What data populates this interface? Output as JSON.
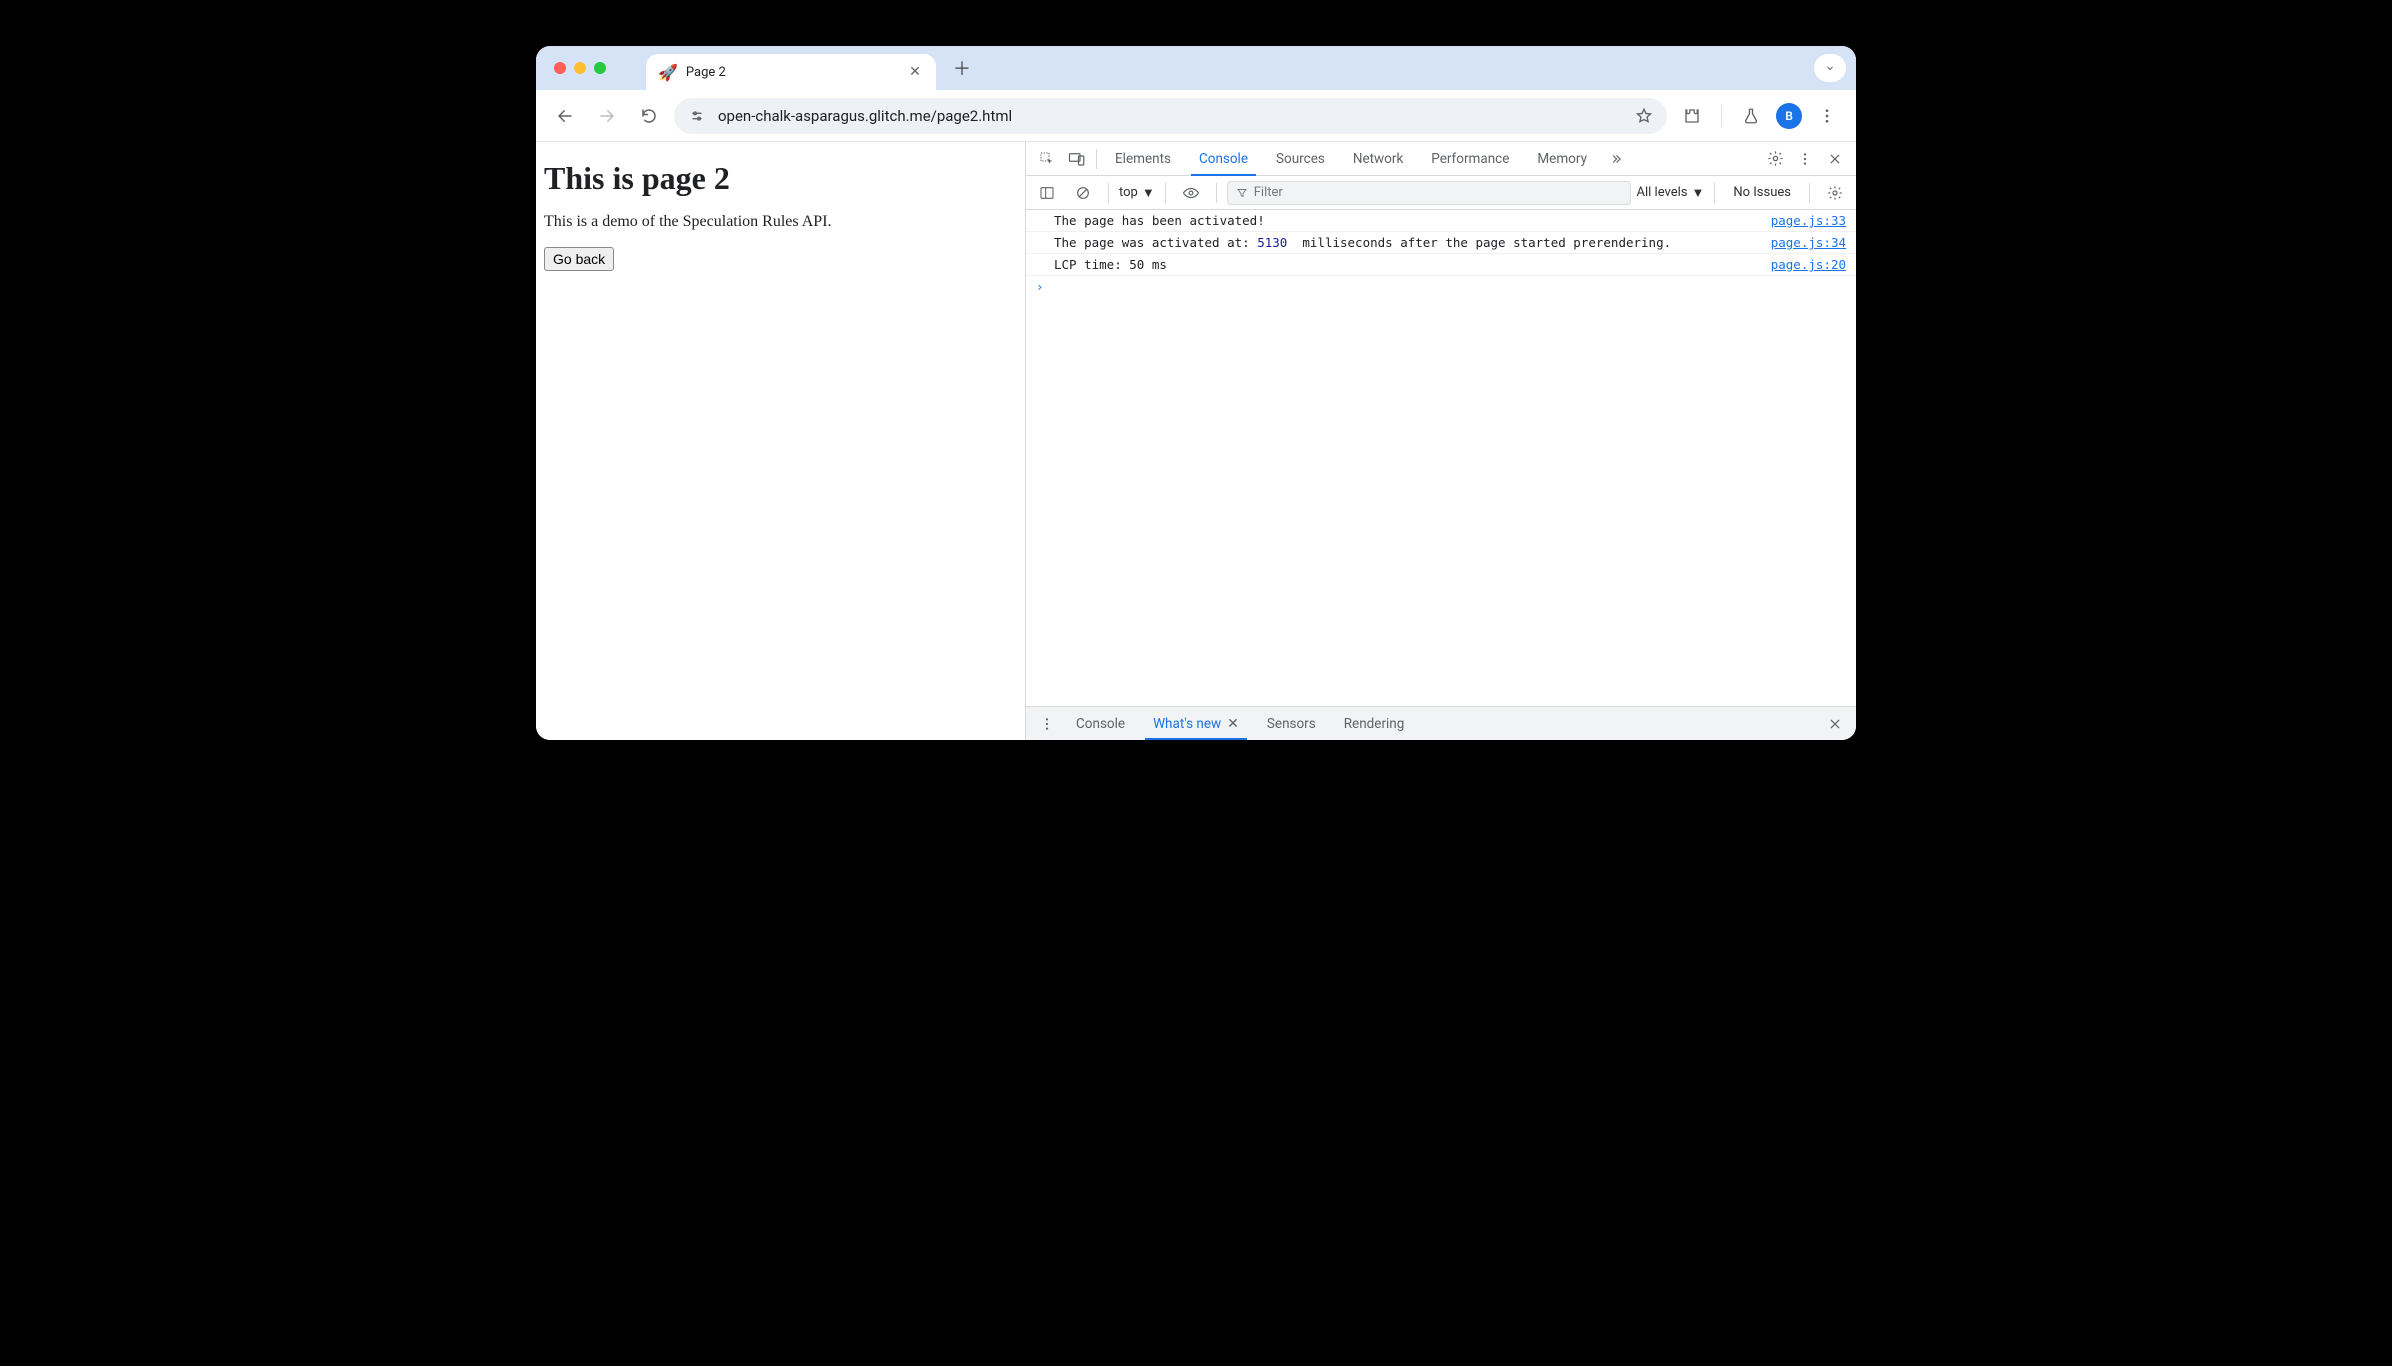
{
  "tab": {
    "favicon": "🚀",
    "title": "Page 2"
  },
  "toolbar": {
    "url": "open-chalk-asparagus.glitch.me/page2.html",
    "avatar_letter": "B"
  },
  "page": {
    "heading": "This is page 2",
    "body": "This is a demo of the Speculation Rules API.",
    "button": "Go back"
  },
  "devtools": {
    "tabs": [
      "Elements",
      "Console",
      "Sources",
      "Network",
      "Performance",
      "Memory"
    ],
    "active_tab": "Console",
    "context": "top",
    "filter_placeholder": "Filter",
    "levels_label": "All levels",
    "issues_label": "No Issues",
    "logs": [
      {
        "msg_pre": "The page has been activated!",
        "num": "",
        "msg_post": "",
        "src": "page.js:33"
      },
      {
        "msg_pre": "The page was activated at: ",
        "num": "5130",
        "msg_post": "  milliseconds after the page started prerendering.",
        "src": "page.js:34"
      },
      {
        "msg_pre": "LCP time: 50 ms",
        "num": "",
        "msg_post": "",
        "src": "page.js:20"
      }
    ],
    "drawer_tabs": [
      "Console",
      "What's new",
      "Sensors",
      "Rendering"
    ],
    "drawer_active": "What's new"
  }
}
